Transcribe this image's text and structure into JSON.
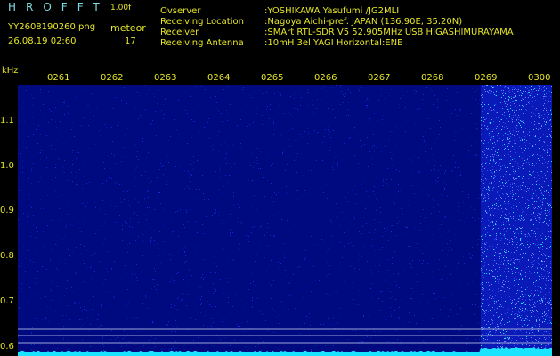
{
  "header": {
    "app_title": "HROFFT",
    "version": "1.00f",
    "file_name": "YY2608190260.png",
    "timestamp": "26.08.19 02:60",
    "mode_label": "meteor",
    "count": "17"
  },
  "info": [
    {
      "key": "Ovserver",
      "value": ":YOSHIKAWA Yasufumi /JG2MLI"
    },
    {
      "key": "Receiving Location",
      "value": ":Nagoya Aichi-pref. JAPAN (136.90E, 35.20N)"
    },
    {
      "key": "Receiver",
      "value": ":SMArt RTL-SDR V5 52.905MHz USB HIGASHIMURAYAMA"
    },
    {
      "key": "Receiving Antenna",
      "value": ":10mH 3el.YAGI Horizontal:ENE"
    }
  ],
  "chart_data": {
    "type": "heatmap",
    "ylabel": "kHz",
    "x_ticks": [
      "0261",
      "0262",
      "0263",
      "0264",
      "0265",
      "0266",
      "0267",
      "0268",
      "0269",
      "0300"
    ],
    "y_ticks": [
      "1.1",
      "1.0",
      "0.9",
      "0.8",
      "0.7",
      "0.6"
    ],
    "ylim": [
      0.58,
      1.18
    ],
    "colors": {
      "background": "#000000",
      "noise_low": "#000a80",
      "noise_high": "#1428d8",
      "signal": "#19e3ff",
      "text": "#e6e62a"
    }
  }
}
